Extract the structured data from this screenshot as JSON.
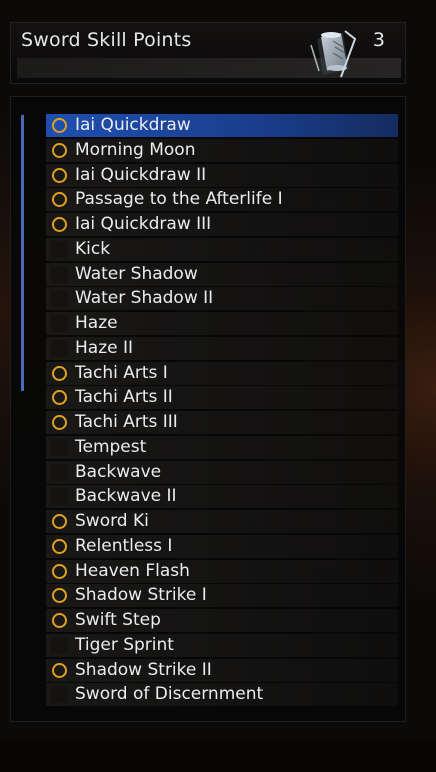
{
  "header": {
    "title": "Sword Skill Points",
    "points": "3",
    "icon": "scroll-icon"
  },
  "colors": {
    "selected": "#1e4fb0",
    "learned_marker": "#e0a020",
    "scrollbar": "#4a6ab8"
  },
  "skills": [
    {
      "name": "Iai Quickdraw",
      "learned": true,
      "selected": true
    },
    {
      "name": "Morning Moon",
      "learned": true
    },
    {
      "name": "Iai Quickdraw II",
      "learned": true
    },
    {
      "name": "Passage to the Afterlife I",
      "learned": true
    },
    {
      "name": "Iai Quickdraw III",
      "learned": true
    },
    {
      "name": "Kick",
      "learned": false
    },
    {
      "name": "Water Shadow",
      "learned": false
    },
    {
      "name": "Water Shadow II",
      "learned": false
    },
    {
      "name": "Haze",
      "learned": false
    },
    {
      "name": "Haze II",
      "learned": false
    },
    {
      "name": "Tachi Arts I",
      "learned": true
    },
    {
      "name": "Tachi Arts II",
      "learned": true
    },
    {
      "name": "Tachi Arts III",
      "learned": true
    },
    {
      "name": "Tempest",
      "learned": false
    },
    {
      "name": "Backwave",
      "learned": false
    },
    {
      "name": "Backwave II",
      "learned": false
    },
    {
      "name": "Sword Ki",
      "learned": true
    },
    {
      "name": "Relentless I",
      "learned": true
    },
    {
      "name": "Heaven Flash",
      "learned": true
    },
    {
      "name": "Shadow Strike I",
      "learned": true
    },
    {
      "name": "Swift Step",
      "learned": true
    },
    {
      "name": "Tiger Sprint",
      "learned": false
    },
    {
      "name": "Shadow Strike II",
      "learned": true
    },
    {
      "name": "Sword of Discernment",
      "learned": false
    }
  ]
}
